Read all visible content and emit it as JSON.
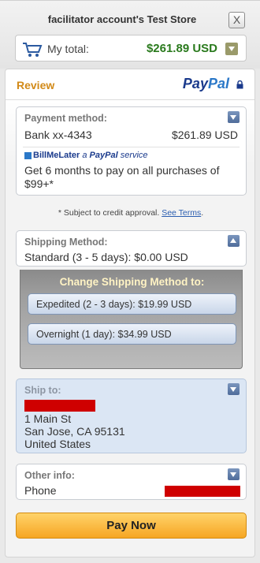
{
  "header": {
    "store_title": "facilitator account's Test Store",
    "close_label": "X",
    "total_label": "My total:",
    "total_amount": "$261.89 USD"
  },
  "review": {
    "title": "Review",
    "paypal_logo_pay": "Pay",
    "paypal_logo_pal": "Pal"
  },
  "payment": {
    "title": "Payment method:",
    "method": "Bank xx-4343",
    "amount": "$261.89 USD",
    "bml_brand": "BillMeLater",
    "bml_service_prefix": "a",
    "bml_service_paypal": "PayPal",
    "bml_service_suffix": "service",
    "bml_text": "Get 6 months to pay on all purchases of $99+*"
  },
  "credit_note": {
    "text": "* Subject to credit approval.",
    "link": "See Terms",
    "suffix": "."
  },
  "shipping": {
    "title": "Shipping Method:",
    "selected": "Standard (3 - 5 days): $0.00 USD",
    "change_title": "Change Shipping Method to:",
    "options": [
      "Expedited (2 - 3 days): $19.99 USD",
      "Overnight (1 day): $34.99 USD"
    ]
  },
  "ship_to": {
    "title": "Ship to:",
    "address": [
      "1 Main St",
      "San Jose, CA 95131",
      "United States"
    ]
  },
  "other_info": {
    "title": "Other info:",
    "phone_label": "Phone"
  },
  "pay_button": "Pay Now",
  "colors": {
    "total_green": "#2a7a1d",
    "review_orange": "#d28a18",
    "paypal_navy": "#1a3a8c",
    "redaction_red": "#cf0000",
    "pay_button": "#f6a623"
  }
}
